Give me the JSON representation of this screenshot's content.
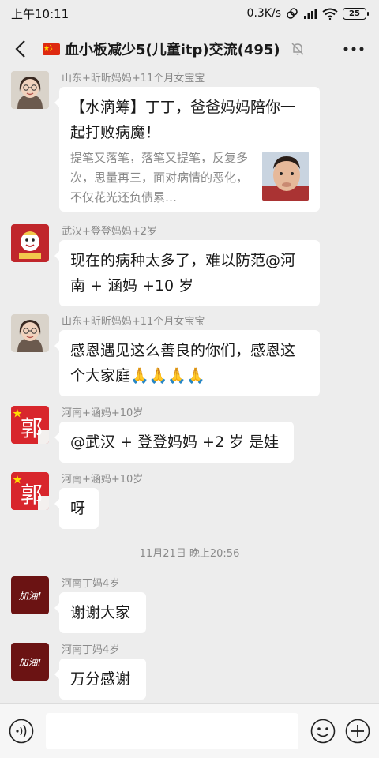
{
  "status_bar": {
    "time": "上午10:11",
    "network_speed": "0.3K/s",
    "battery": "25"
  },
  "header": {
    "flag_icon": "china-flag-icon",
    "title": "血小板减少5(儿童itp)交流(495)"
  },
  "messages": [
    {
      "sender": "山东+昕昕妈妈+11个月女宝宝",
      "card_title": "【水滴筹】丁丁，爸爸妈妈陪你一起打败病魔！",
      "card_desc": "提笔又落笔，落笔又提笔，反复多次，思量再三，面对病情的恶化，不仅花光还负债累…"
    },
    {
      "sender": "武汉+登登妈妈+2岁",
      "text": "现在的病种太多了，难以防范@河南 + 涵妈 +10 岁"
    },
    {
      "sender": "山东+昕昕妈妈+11个月女宝宝",
      "text": "感恩遇见这么善良的你们，感恩这个大家庭🙏🙏🙏🙏"
    },
    {
      "sender": "河南+涵妈+10岁",
      "text": "@武汉 + 登登妈妈 +2 岁  是娃"
    },
    {
      "sender": "河南+涵妈+10岁",
      "text": "呀"
    },
    {
      "sender": "河南丁妈4岁",
      "text": "谢谢大家"
    },
    {
      "sender": "河南丁妈4岁",
      "text": "万分感谢"
    }
  ],
  "timestamp": "11月21日 晚上20:56",
  "avatars": {
    "guo_char": "郭",
    "jiayou_text": "加油!"
  },
  "input": {
    "placeholder": ""
  },
  "colors": {
    "background": "#ededed",
    "bubble": "#ffffff",
    "sender_text": "#8a8a8a",
    "avatar_red": "#d8262c",
    "avatar_darkred": "#6b1313"
  }
}
